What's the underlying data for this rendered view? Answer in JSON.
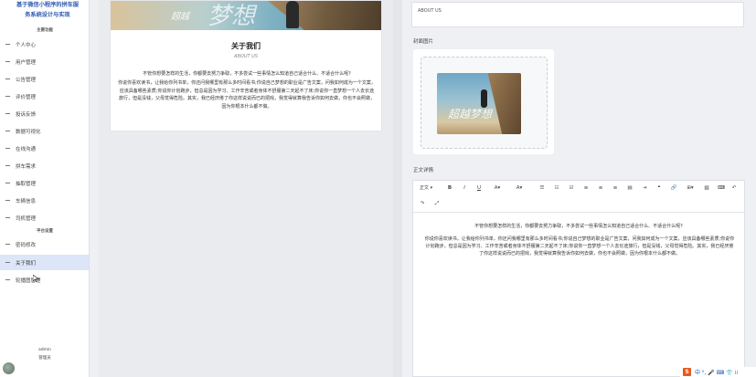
{
  "sidebar": {
    "title_line1": "基于微信小程序的拼车服",
    "title_line2": "务系统设计与实现",
    "section_main": "主要功能",
    "section_platform": "平台设置",
    "items": [
      {
        "label": "个人中心"
      },
      {
        "label": "用户管理"
      },
      {
        "label": "公告管理"
      },
      {
        "label": "评价管理"
      },
      {
        "label": "投诉反馈"
      },
      {
        "label": "数据可视化"
      },
      {
        "label": "在线沟通"
      },
      {
        "label": "拼车需求"
      },
      {
        "label": "抽取管理"
      },
      {
        "label": "车辆信息"
      },
      {
        "label": "司机管理"
      }
    ],
    "platform_items": [
      {
        "label": "密码修改"
      },
      {
        "label": "关于我们"
      },
      {
        "label": "轮播图管理"
      }
    ],
    "user_name": "admin",
    "user_role": "管理员"
  },
  "preview": {
    "banner_text_small": "超越",
    "banner_text_big": "梦想",
    "title": "关于我们",
    "subtitle": "ABOUT US",
    "lead": "不管你想要怎样的生活，你都要去努力争取，不多尝试一些事情怎么知道自己适合什么、不适合什么呢?",
    "body": "你说你喜欢读书，让我给你列书单，你还问我哪里有那么多时间看书;你说自己梦想的职业是广告文案，问我如何成为一个文案，应该具备哪些素质;你说你计划跑步，但总是因为学习、工作辛苦或者身体不舒服第二天起不了床;你说你一直梦想一个人去长途旅行，但是没钱，父母觉得危险。其实，我已经厌倦了你这样说说而已的把戏，我觉得就算我告诉你如何去做，你也不会照做，因为你根本什么都不做。"
  },
  "form": {
    "subtitle_value": "ABOUT US",
    "cover_label": "封面图片",
    "content_label": "正文详情",
    "cover_text": "超越梦想"
  },
  "editor": {
    "heading_select": "正文",
    "lead": "不管你想要怎样的生活，你都要去努力争取，不多尝试一些事情怎么知道自己适合什么、不适合什么呢?",
    "body": "你说你喜欢读书，让我给你列书单，你还问我哪里有那么多时间看书;你说自己梦想的职业是广告文案，问我如何成为一个文案，应该具备哪些素质;你说你计划跑步，但总是因为学习、工作辛苦或者身体不舒服第二天起不了床;你说你一直梦想一个人去长途旅行，但是没钱，父母觉得危险。其实，我已经厌倦了你这样说说而已的把戏，我觉得就算我告诉你如何去做，你也不会照做，因为你根本什么都不做。"
  },
  "ime": {
    "badge": "S",
    "text": "中 ⁰, 🎤 ⌨ 👕 ⁞⁞"
  }
}
